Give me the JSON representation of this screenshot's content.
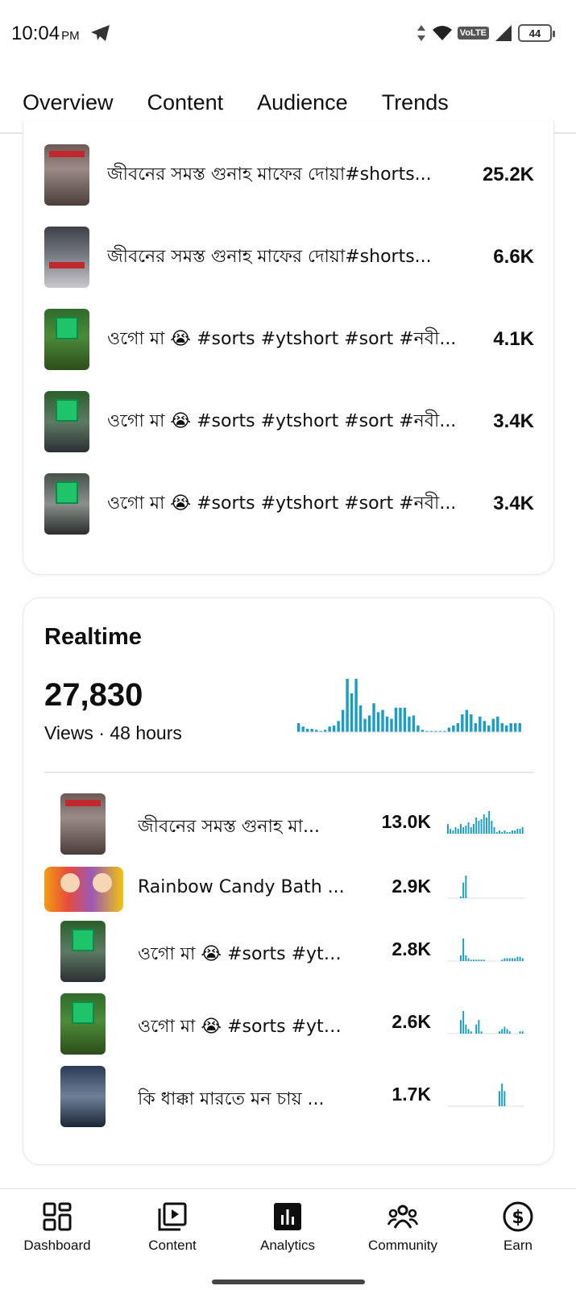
{
  "status_bar": {
    "time": "10:04",
    "ampm": "PM",
    "volte": "VoLTE",
    "battery": "44"
  },
  "tabs": [
    {
      "label": "Overview"
    },
    {
      "label": "Content"
    },
    {
      "label": "Audience"
    },
    {
      "label": "Trends"
    }
  ],
  "top_content": {
    "rows": [
      {
        "title": "জীবনের সমস্ত গুনাহ মাফের দোয়া#shorts...",
        "value": "25.2K"
      },
      {
        "title": "জীবনের সমস্ত গুনাহ মাফের দোয়া#shorts...",
        "value": "6.6K"
      },
      {
        "title": "ওগো মা 😭 #sorts #ytshort #sort #নবী...",
        "value": "4.1K"
      },
      {
        "title": "ওগো মা 😭 #sorts #ytshort #sort #নবী...",
        "value": "3.4K"
      },
      {
        "title": "ওগো মা 😭 #sorts #ytshort #sort #নবী...",
        "value": "3.4K"
      }
    ]
  },
  "realtime": {
    "title": "Realtime",
    "total": "27,830",
    "subtitle": "Views · 48 hours",
    "bar_color": "#1a9cc5",
    "chart_data": {
      "type": "bar",
      "values": [
        8,
        5,
        3,
        3,
        2,
        1,
        2,
        5,
        6,
        10,
        20,
        48,
        35,
        48,
        24,
        12,
        15,
        26,
        18,
        20,
        14,
        12,
        22,
        22,
        22,
        14,
        15,
        6,
        2,
        1,
        1,
        1,
        1,
        1,
        4,
        6,
        8,
        16,
        20,
        16,
        8,
        14,
        10,
        6,
        12,
        14,
        8,
        6,
        8,
        8,
        8
      ]
    },
    "rows": [
      {
        "title": "জীবনের সমস্ত গুনাহ মা...",
        "value": "13.0K",
        "spark": [
          6,
          3,
          2,
          4,
          3,
          6,
          4,
          5,
          7,
          4,
          6,
          10,
          8,
          9,
          12,
          10,
          14,
          8,
          4,
          1,
          2,
          1,
          2,
          1,
          1,
          2,
          2,
          3,
          3,
          4
        ]
      },
      {
        "title": "Rainbow Candy Bath ...",
        "value": "2.9K",
        "spark": [
          0,
          0,
          0,
          0,
          0,
          2,
          18,
          26,
          0,
          0,
          0,
          0,
          0,
          0,
          0,
          0,
          0,
          0,
          0,
          0,
          0,
          0,
          0,
          0,
          0,
          0,
          0,
          0,
          0,
          0
        ]
      },
      {
        "title": "ওগো মা 😭 #sorts #yts...",
        "value": "2.8K",
        "spark": [
          0,
          0,
          0,
          0,
          0,
          4,
          16,
          4,
          2,
          1,
          1,
          1,
          1,
          1,
          1,
          0,
          0,
          0,
          0,
          0,
          0,
          1,
          2,
          2,
          2,
          2,
          2,
          3,
          3,
          2
        ]
      },
      {
        "title": "ওগো মা 😭 #sorts #yts...",
        "value": "2.6K",
        "spark": [
          0,
          0,
          0,
          0,
          0,
          6,
          10,
          4,
          2,
          1,
          0,
          4,
          6,
          1,
          0,
          0,
          0,
          0,
          0,
          0,
          1,
          2,
          3,
          2,
          1,
          0,
          0,
          0,
          1,
          1
        ]
      },
      {
        "title": "কি ধাক্কা মারতে মন চায় ...",
        "value": "1.7K",
        "spark": [
          0,
          0,
          0,
          0,
          0,
          0,
          0,
          0,
          0,
          0,
          0,
          0,
          0,
          0,
          0,
          0,
          0,
          0,
          0,
          0,
          8,
          12,
          8,
          0,
          0,
          0,
          0,
          0,
          0,
          0
        ]
      }
    ]
  },
  "bottom_nav": [
    {
      "label": "Dashboard",
      "icon": "dashboard-icon"
    },
    {
      "label": "Content",
      "icon": "content-icon"
    },
    {
      "label": "Analytics",
      "icon": "analytics-icon"
    },
    {
      "label": "Community",
      "icon": "community-icon"
    },
    {
      "label": "Earn",
      "icon": "earn-icon"
    }
  ]
}
